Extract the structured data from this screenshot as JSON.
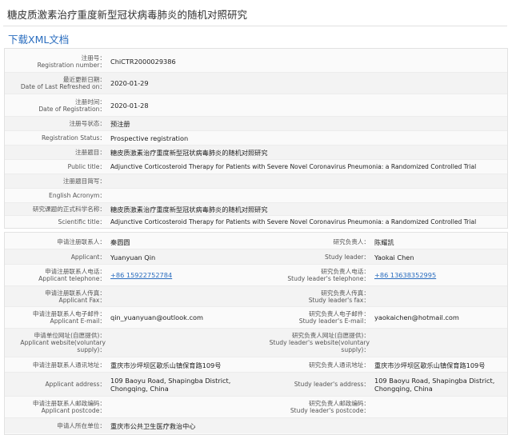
{
  "title": "糖皮质激素治疗重度新型冠状病毒肺炎的随机对照研究",
  "download_label": "下载XML文档",
  "registration": [
    {
      "label_zh": "注册号：",
      "label_en": "Registration number：",
      "value": "ChiCTR2000029386"
    },
    {
      "label_zh": "最近更新日期：",
      "label_en": "Date of Last Refreshed on：",
      "value": "2020-01-29"
    },
    {
      "label_zh": "注册时间：",
      "label_en": "Date of Registration：",
      "value": "2020-01-28"
    },
    {
      "label_zh": "注册号状态：",
      "label_en": "",
      "value": "预注册"
    },
    {
      "label_zh": "",
      "label_en": "Registration Status：",
      "value": "Prospective registration"
    },
    {
      "label_zh": "注册题目：",
      "label_en": "",
      "value": "糖皮质激素治疗重度新型冠状病毒肺炎的随机对照研究"
    },
    {
      "label_zh": "",
      "label_en": "Public title：",
      "value": "Adjunctive Corticosteroid Therapy for Patients with Severe Novel Coronavirus Pneumonia: a Randomized Controlled Trial"
    },
    {
      "label_zh": "注册题目简写：",
      "label_en": "",
      "value": ""
    },
    {
      "label_zh": "",
      "label_en": "English Acronym：",
      "value": ""
    },
    {
      "label_zh": "研究课题的正式科学名称：",
      "label_en": "",
      "value": "糖皮质激素治疗重度新型冠状病毒肺炎的随机对照研究"
    },
    {
      "label_zh": "",
      "label_en": "Scientific title：",
      "value": "Adjunctive Corticosteroid Therapy for Patients with Severe Novel Coronavirus Pneumonia: a Randomized Controlled Trial"
    }
  ],
  "contacts": [
    {
      "left": {
        "label_zh": "申请注册联系人：",
        "label_en": "",
        "value": "秦圆圆"
      },
      "right": {
        "label_zh": "研究负责人：",
        "label_en": "",
        "value": "陈耀凯"
      }
    },
    {
      "left": {
        "label_zh": "",
        "label_en": "Applicant：",
        "value": "Yuanyuan Qin"
      },
      "right": {
        "label_zh": "",
        "label_en": "Study leader：",
        "value": "Yaokai Chen"
      }
    },
    {
      "left": {
        "label_zh": "申请注册联系人电话：",
        "label_en": "Applicant telephone：",
        "value": "+86 15922752784"
      },
      "right": {
        "label_zh": "研究负责人电话：",
        "label_en": "Study leader's telephone：",
        "value": "+86 13638352995"
      }
    },
    {
      "left": {
        "label_zh": "申请注册联系人传真：",
        "label_en": "Applicant Fax：",
        "value": ""
      },
      "right": {
        "label_zh": "研究负责人传真：",
        "label_en": "Study leader's fax：",
        "value": ""
      }
    },
    {
      "left": {
        "label_zh": "申请注册联系人电子邮件：",
        "label_en": "Applicant E-mail：",
        "value": "qin_yuanyuan@outlook.com"
      },
      "right": {
        "label_zh": "研究负责人电子邮件：",
        "label_en": "Study leader's E-mail：",
        "value": "yaokaichen@hotmail.com"
      }
    },
    {
      "left": {
        "label_zh": "申请单位网址(自愿提供)：",
        "label_en": "Applicant website(voluntary",
        "label_en2": "supply)：",
        "value": ""
      },
      "right": {
        "label_zh": "研究负责人网址(自愿提供)：",
        "label_en": "Study leader's website(voluntary",
        "label_en2": "supply)：",
        "value": ""
      }
    },
    {
      "left": {
        "label_zh": "申请注册联系人通讯地址：",
        "label_en": "",
        "value": "重庆市沙坪坝区歌乐山镇保育路109号"
      },
      "right": {
        "label_zh": "研究负责人通讯地址：",
        "label_en": "",
        "value": "重庆市沙坪坝区歌乐山镇保育路109号"
      }
    },
    {
      "left": {
        "label_zh": "",
        "label_en": "Applicant address：",
        "value": "109 Baoyu Road, Shapingba District, Chongqing, China"
      },
      "right": {
        "label_zh": "",
        "label_en": "Study leader's address：",
        "value": "109 Baoyu Road, Shapingba District, Chongqing, China"
      }
    },
    {
      "left": {
        "label_zh": "申请注册联系人邮政编码：",
        "label_en": "Applicant postcode：",
        "value": ""
      },
      "right": {
        "label_zh": "研究负责人邮政编码：",
        "label_en": "Study leader's postcode：",
        "value": ""
      }
    },
    {
      "left": {
        "label_zh": "申请人所在单位：",
        "label_en": "",
        "value": "重庆市公共卫生医疗救治中心"
      },
      "right": {
        "label_zh": "",
        "label_en": "",
        "value": ""
      }
    }
  ]
}
